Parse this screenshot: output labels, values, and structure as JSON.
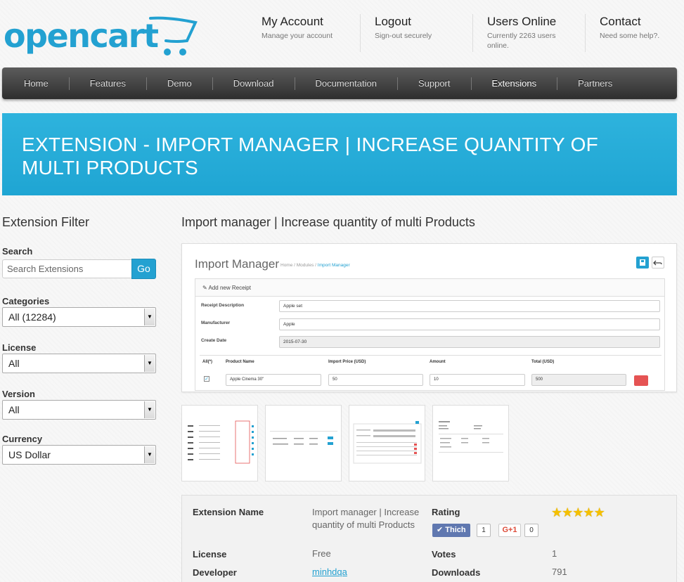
{
  "logo": {
    "text": "opencart"
  },
  "header_links": [
    {
      "title": "My Account",
      "subtitle": "Manage your account"
    },
    {
      "title": "Logout",
      "subtitle": "Sign-out securely"
    },
    {
      "title": "Users Online",
      "subtitle": "Currently 2263 users online."
    },
    {
      "title": "Contact",
      "subtitle": "Need some help?."
    }
  ],
  "nav": [
    {
      "label": "Home"
    },
    {
      "label": "Features"
    },
    {
      "label": "Demo"
    },
    {
      "label": "Download"
    },
    {
      "label": "Documentation"
    },
    {
      "label": "Support"
    },
    {
      "label": "Extensions"
    },
    {
      "label": "Partners"
    }
  ],
  "banner": {
    "title": "EXTENSION - IMPORT MANAGER | INCREASE QUANTITY OF MULTI PRODUCTS"
  },
  "sidebar": {
    "title": "Extension Filter",
    "search_label": "Search",
    "search_placeholder": "Search Extensions",
    "go_label": "Go",
    "categories_label": "Categories",
    "categories_value": "All (12284)",
    "license_label": "License",
    "license_value": "All",
    "version_label": "Version",
    "version_value": "All",
    "currency_label": "Currency",
    "currency_value": "US Dollar"
  },
  "main": {
    "title": "Import manager | Increase quantity of multi Products",
    "preview": {
      "title": "Import Manager",
      "crumb_home": "Home",
      "crumb_modules": "Modules",
      "crumb_current": "Import Manager",
      "panel_heading": "Add new Receipt",
      "receipt_label": "Receipt Description",
      "receipt_value": "Apple set",
      "manufacturer_label": "Manufacturer",
      "manufacturer_value": "Apple",
      "date_label": "Create Date",
      "date_value": "2015-07-30",
      "col_all": "All(*)",
      "col_product": "Product Name",
      "col_price": "Import Price (USD)",
      "col_amount": "Amount",
      "col_total": "Total (USD)",
      "row_product": "Apple Cinema 30\"",
      "row_price": "50",
      "row_amount": "10",
      "row_total": "500"
    }
  },
  "details": {
    "name_label": "Extension Name",
    "name_value": "Import manager | Increase quantity of multi Products",
    "rating_label": "Rating",
    "rating_stars": 5,
    "like_label": "Thich",
    "like_count": "1",
    "gplus_label": "G+1",
    "gplus_count": "0",
    "license_label": "License",
    "license_value": "Free",
    "votes_label": "Votes",
    "votes_value": "1",
    "developer_label": "Developer",
    "developer_value": "minhdqa",
    "downloads_label": "Downloads",
    "downloads_value": "791"
  },
  "colors": {
    "brand": "#23a1d1",
    "nav_dark": "#3a3a3a",
    "star": "#f5c000"
  }
}
